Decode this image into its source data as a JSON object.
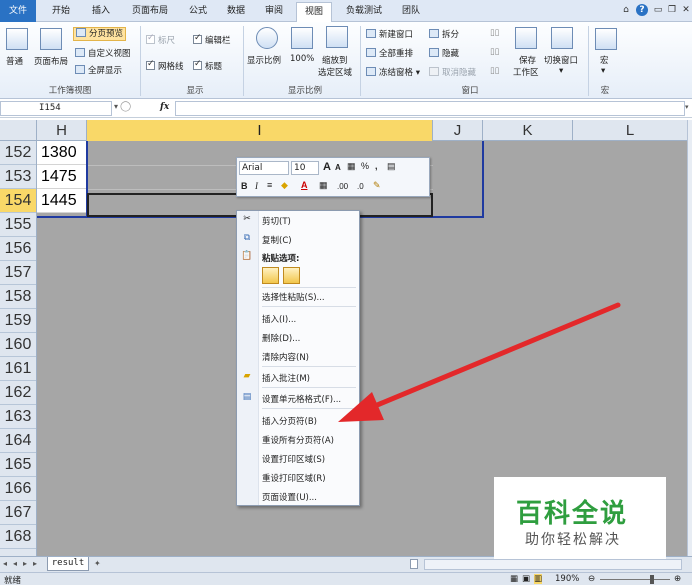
{
  "tabs": [
    "文件",
    "开始",
    "插入",
    "页面布局",
    "公式",
    "数据",
    "审阅",
    "视图",
    "负载测试",
    "团队"
  ],
  "active_tab": "视图",
  "ribbon": {
    "workbook_views": {
      "normal": "普通",
      "page_layout": "页面布局",
      "page_break_preview": "分页预览",
      "custom_views": "自定义视图",
      "full_screen": "全屏显示",
      "group_label": "工作簿视图"
    },
    "show": {
      "ruler": "标尺",
      "formula_bar": "编辑栏",
      "gridlines": "网格线",
      "headings": "标题",
      "group_label": "显示"
    },
    "zoom": {
      "zoom": "显示比例",
      "hundred": "100%",
      "zoom_to_selection_1": "缩放到",
      "zoom_to_selection_2": "选定区域",
      "group_label": "显示比例"
    },
    "window": {
      "new_window": "新建窗口",
      "arrange_all": "全部重排",
      "freeze_panes": "冻结窗格",
      "split": "拆分",
      "hide": "隐藏",
      "unhide": "取消隐藏",
      "save_workspace_1": "保存",
      "save_workspace_2": "工作区",
      "switch_windows": "切换窗口",
      "group_label": "窗口"
    },
    "macros": {
      "macros": "宏",
      "group_label": "宏"
    }
  },
  "formula_bar": {
    "name_box": "I154",
    "fx": "fx",
    "formula": ""
  },
  "columns": [
    "H",
    "I",
    "J",
    "K",
    "L"
  ],
  "rows": [
    "152",
    "153",
    "154",
    "155",
    "156",
    "157",
    "158",
    "159",
    "160",
    "161",
    "162",
    "163",
    "164",
    "165",
    "166",
    "167",
    "168"
  ],
  "cells_H": [
    "1380",
    "1475",
    "1445"
  ],
  "mini_toolbar": {
    "font": "Arial",
    "size": "10",
    "grow": "A",
    "shrink": "A",
    "percent": "%",
    "comma": ",",
    "bold": "B",
    "italic": "I",
    "font_color": "A",
    "inc_dec": ".00",
    "dec_dec": ".0"
  },
  "context_menu": {
    "cut": "剪切(T)",
    "copy": "复制(C)",
    "paste_options": "粘贴选项:",
    "paste_special": "选择性粘贴(S)...",
    "insert": "插入(I)...",
    "delete": "删除(D)...",
    "clear_contents": "清除内容(N)",
    "insert_comment": "插入批注(M)",
    "format_cells": "设置单元格格式(F)...",
    "insert_page_break": "插入分页符(B)",
    "reset_page_breaks": "重设所有分页符(A)",
    "set_print_area": "设置打印区域(S)",
    "reset_print_area": "重设打印区域(R)",
    "page_setup": "页面设置(U)..."
  },
  "sheet_tab": "result",
  "status": {
    "ready": "就绪",
    "zoom": "190%"
  },
  "watermark": {
    "title": "百科全说",
    "subtitle": "助你轻松解决"
  },
  "colors": {
    "file_tab": "#2a72c4",
    "selected_header": "#f9d868",
    "page_border": "#1f3aa0",
    "arrow": "#e3282a",
    "watermark_green": "#2f9e3f"
  }
}
